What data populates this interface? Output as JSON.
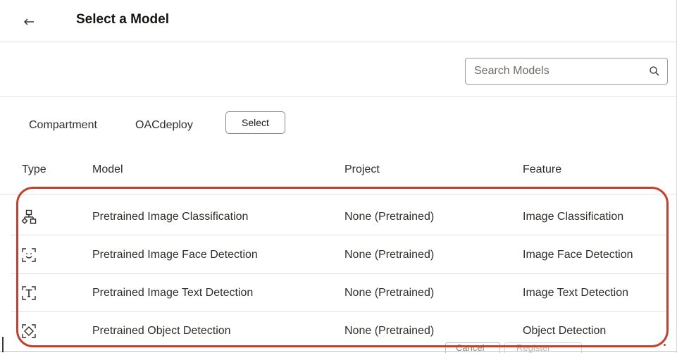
{
  "dialog": {
    "title": "Select a Model",
    "back_icon": "arrow-left-icon"
  },
  "search": {
    "placeholder": "Search Models",
    "value": "",
    "icon": "search-icon"
  },
  "compartment": {
    "label": "Compartment",
    "value": "OACdeploy",
    "select_label": "Select"
  },
  "table": {
    "columns": [
      "Type",
      "Model",
      "Project",
      "Feature"
    ],
    "rows": [
      {
        "type_icon": "image-classification-icon",
        "model": "Pretrained Image Classification",
        "project": "None (Pretrained)",
        "feature": "Image Classification"
      },
      {
        "type_icon": "face-detection-icon",
        "model": "Pretrained Image Face Detection",
        "project": "None (Pretrained)",
        "feature": "Image Face Detection"
      },
      {
        "type_icon": "text-detection-icon",
        "model": "Pretrained Image Text Detection",
        "project": "None (Pretrained)",
        "feature": "Image Text Detection"
      },
      {
        "type_icon": "object-detection-icon",
        "model": "Pretrained Object Detection",
        "project": "None (Pretrained)",
        "feature": "Object Detection"
      }
    ]
  },
  "footer": {
    "cancel_label": "Cancel",
    "register_label": "Register"
  },
  "colors": {
    "highlight": "#c2412d",
    "text": "#312d2a",
    "divider": "#e4e2df"
  }
}
